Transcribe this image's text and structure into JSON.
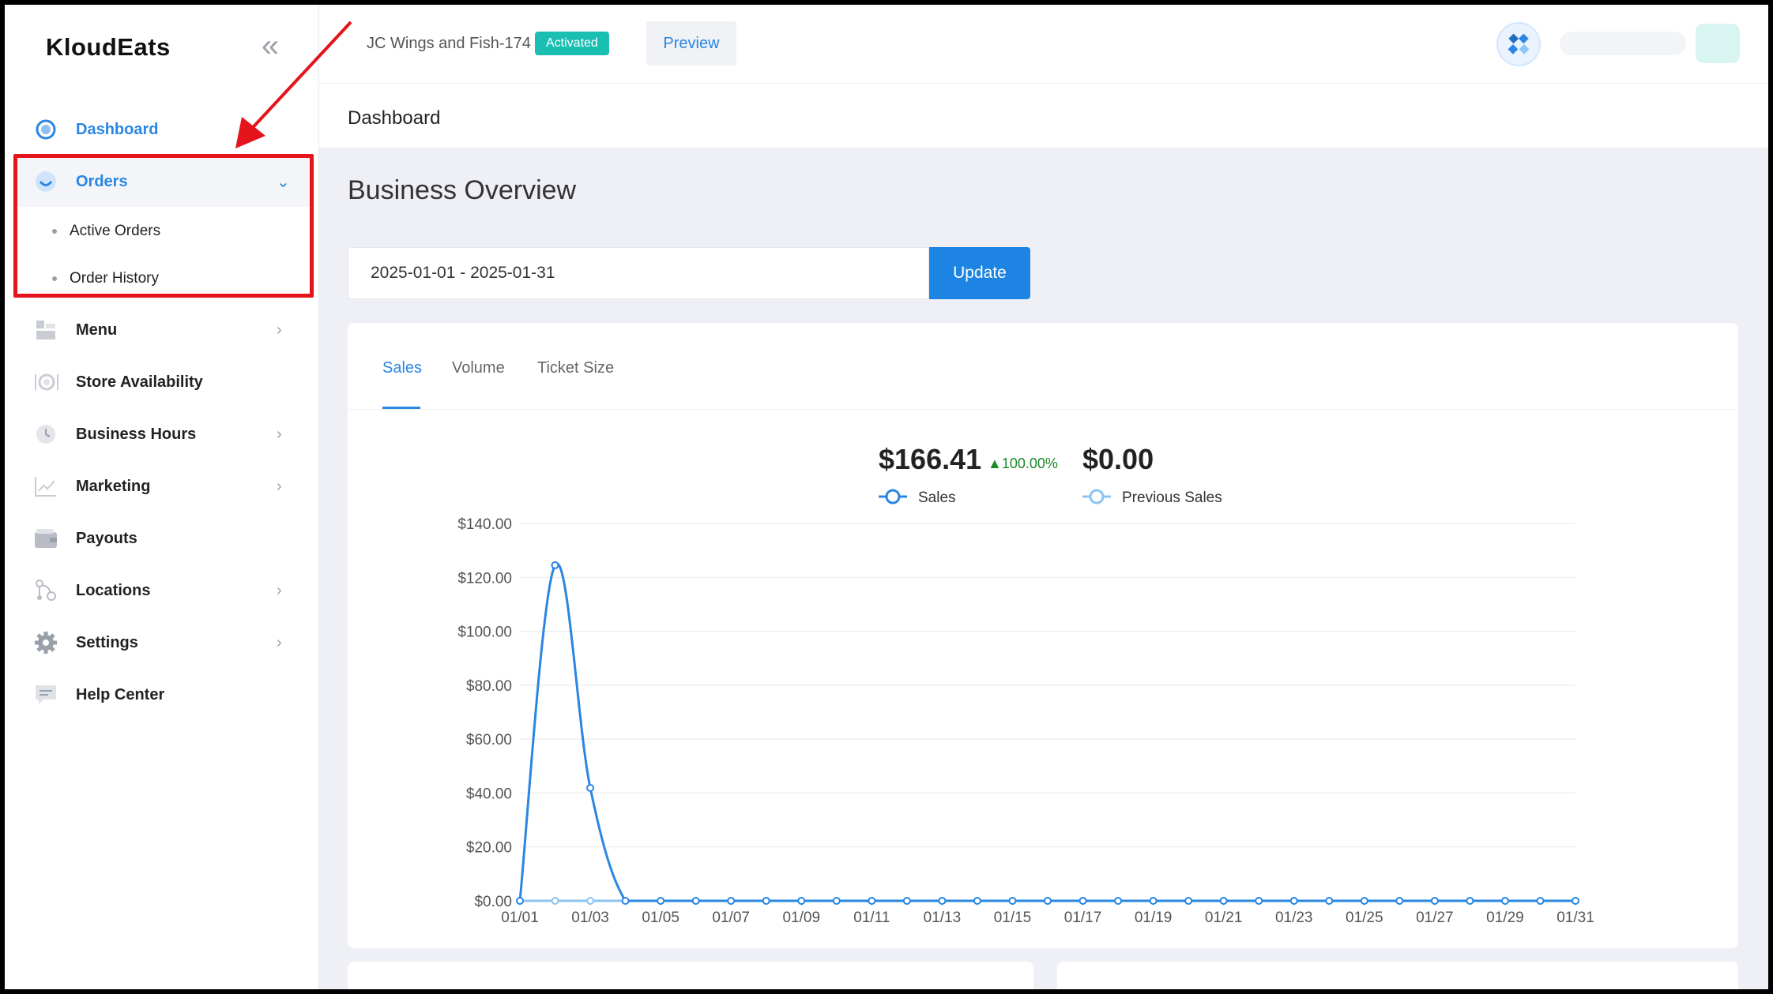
{
  "sidebar": {
    "logo": "KloudEats",
    "items": [
      {
        "label": "Dashboard",
        "icon": "dashboard-icon"
      },
      {
        "label": "Orders",
        "icon": "orders-icon"
      },
      {
        "label": "Menu",
        "icon": "menu-icon"
      },
      {
        "label": "Store Availability",
        "icon": "store-availability-icon"
      },
      {
        "label": "Business Hours",
        "icon": "clock-icon"
      },
      {
        "label": "Marketing",
        "icon": "chart-line-icon"
      },
      {
        "label": "Payouts",
        "icon": "wallet-icon"
      },
      {
        "label": "Locations",
        "icon": "locations-icon"
      },
      {
        "label": "Settings",
        "icon": "gear-icon"
      },
      {
        "label": "Help Center",
        "icon": "chat-icon"
      }
    ],
    "orders_sub": [
      "Active Orders",
      "Order History"
    ]
  },
  "topbar": {
    "store_name": "JC Wings and Fish-174",
    "status": "Activated",
    "preview": "Preview"
  },
  "page": {
    "title": "Dashboard",
    "section_title": "Business Overview",
    "date_range": "2025-01-01 - 2025-01-31",
    "update": "Update"
  },
  "tabs": [
    "Sales",
    "Volume",
    "Ticket Size"
  ],
  "summary": {
    "sales_value": "$166.41",
    "sales_change": "▲100.00%",
    "sales_label": "Sales",
    "prev_value": "$0.00",
    "prev_label": "Previous Sales"
  },
  "colors": {
    "accent": "#2a86e2",
    "status": "#1bbfb2",
    "change_up": "#1a8a2a",
    "highlight": "#e5131b",
    "prev_series": "#8ec4f2"
  },
  "chart_data": {
    "type": "line",
    "ylim": [
      0,
      140
    ],
    "yticks": [
      "$0.00",
      "$20.00",
      "$40.00",
      "$60.00",
      "$80.00",
      "$100.00",
      "$120.00",
      "$140.00"
    ],
    "xticks": [
      "01/01",
      "01/03",
      "01/05",
      "01/07",
      "01/09",
      "01/11",
      "01/13",
      "01/15",
      "01/17",
      "01/19",
      "01/21",
      "01/23",
      "01/25",
      "01/27",
      "01/29",
      "01/31"
    ],
    "x": [
      "01/01",
      "01/02",
      "01/03",
      "01/04",
      "01/05",
      "01/06",
      "01/07",
      "01/08",
      "01/09",
      "01/10",
      "01/11",
      "01/12",
      "01/13",
      "01/14",
      "01/15",
      "01/16",
      "01/17",
      "01/18",
      "01/19",
      "01/20",
      "01/21",
      "01/22",
      "01/23",
      "01/24",
      "01/25",
      "01/26",
      "01/27",
      "01/28",
      "01/29",
      "01/30",
      "01/31"
    ],
    "series": [
      {
        "name": "Sales",
        "values": [
          0,
          124.5,
          41.9,
          0,
          0,
          0,
          0,
          0,
          0,
          0,
          0,
          0,
          0,
          0,
          0,
          0,
          0,
          0,
          0,
          0,
          0,
          0,
          0,
          0,
          0,
          0,
          0,
          0,
          0,
          0,
          0
        ]
      },
      {
        "name": "Previous Sales",
        "values": [
          0,
          0,
          0,
          0,
          0,
          0,
          0,
          0,
          0,
          0,
          0,
          0,
          0,
          0,
          0,
          0,
          0,
          0,
          0,
          0,
          0,
          0,
          0,
          0,
          0,
          0,
          0,
          0,
          0,
          0,
          0
        ]
      }
    ]
  }
}
